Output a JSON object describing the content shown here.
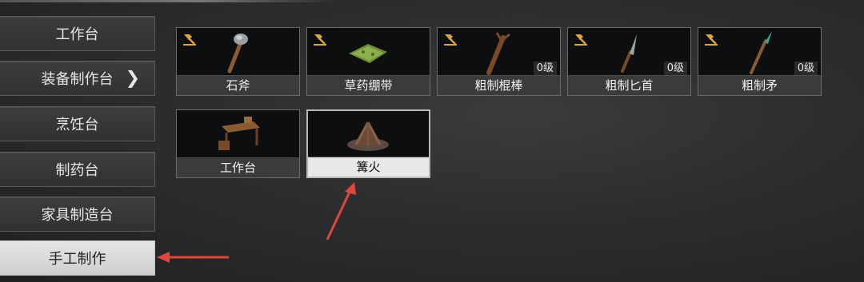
{
  "sidebar": {
    "items": [
      {
        "label": "工作台"
      },
      {
        "label": "装备制作台"
      },
      {
        "label": "烹饪台"
      },
      {
        "label": "制药台"
      },
      {
        "label": "家具制造台"
      },
      {
        "label": "手工制作"
      }
    ]
  },
  "recipes": [
    {
      "label": "石斧",
      "level": ""
    },
    {
      "label": "草药绷带",
      "level": ""
    },
    {
      "label": "粗制棍棒",
      "level": "0级"
    },
    {
      "label": "粗制匕首",
      "level": "0级"
    },
    {
      "label": "粗制矛",
      "level": "0级"
    },
    {
      "label": "工作台",
      "level": ""
    },
    {
      "label": "篝火",
      "level": ""
    }
  ],
  "colors": {
    "accent_icon": "#d9a640",
    "annotation_arrow": "#e0463c"
  }
}
